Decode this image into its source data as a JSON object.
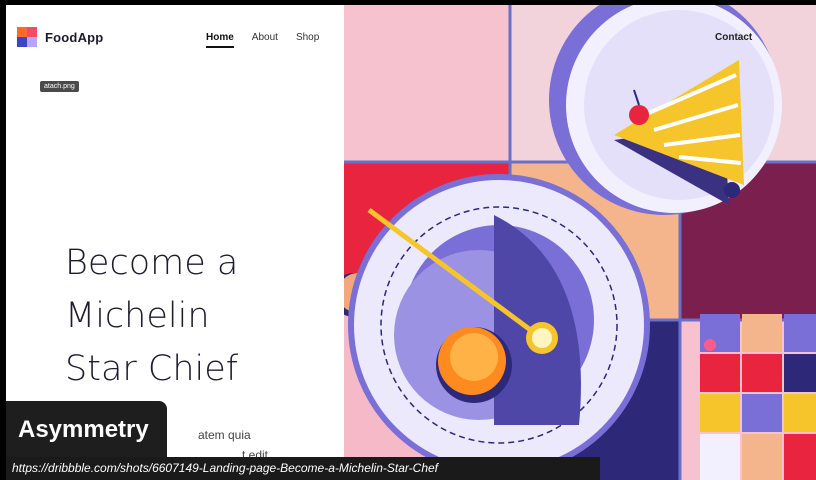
{
  "brand": {
    "name": "FoodApp"
  },
  "nav": {
    "items": [
      "Home",
      "About",
      "Shop"
    ],
    "active": "Home",
    "contact": "Contact"
  },
  "file_tag": "atach.png",
  "hero": {
    "headline_lines": [
      "Become a",
      "Michelin",
      "Star Chief"
    ],
    "subtext_lines": [
      "atem quia",
      "t edit"
    ]
  },
  "overlay": {
    "label": "Asymmetry",
    "url": "https://dribbble.com/shots/6607149-Landing-page-Become-a-Michelin-Star-Chef"
  },
  "colors": {
    "pink": "#f7c2cf",
    "red": "#e8243f",
    "peach": "#f4b48c",
    "plum": "#7b1f4f",
    "violet": "#7a6fd6",
    "navy": "#2d2878",
    "orange": "#ff8a1f",
    "yellow": "#f6c52c"
  },
  "icons": [
    "logo-icon",
    "cake-plate-illustration",
    "dish-illustration"
  ]
}
